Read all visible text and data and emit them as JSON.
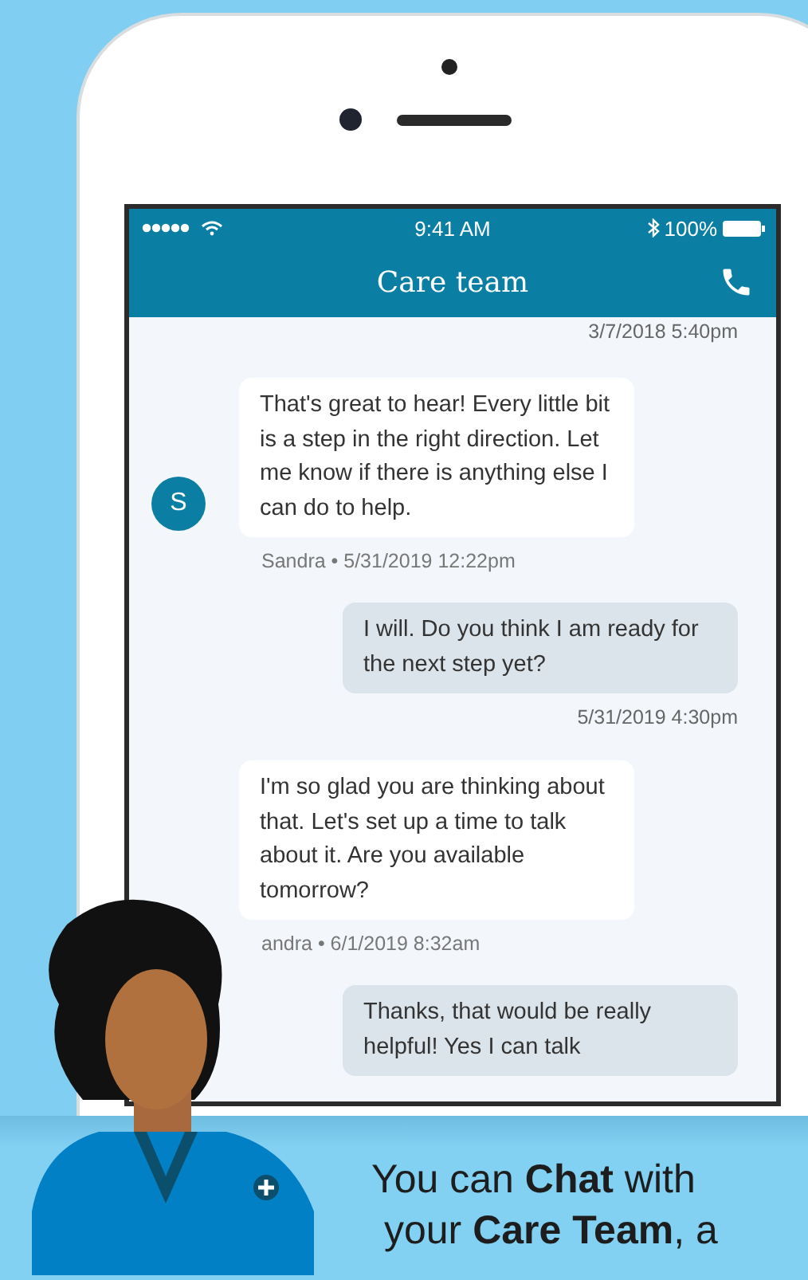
{
  "status_bar": {
    "time": "9:41 AM",
    "battery": "100%"
  },
  "header": {
    "title": "Care team"
  },
  "messages": [
    {
      "kind": "timestamp",
      "text": "3/7/2018 5:40pm"
    },
    {
      "kind": "received",
      "avatar": "S",
      "text": "That's great to hear! Every little bit is a step in the right direction. Let me know if there is anything else I can do to help.",
      "meta": "Sandra • 5/31/2019 12:22pm"
    },
    {
      "kind": "sent",
      "text": "I will. Do you think I am ready for the next step yet?",
      "meta": "5/31/2019 4:30pm"
    },
    {
      "kind": "received",
      "text": "I'm so glad you are thinking about that. Let's set up a time to talk about it. Are you available tomorrow?",
      "meta": "andra • 6/1/2019 8:32am"
    },
    {
      "kind": "sent",
      "text": "Thanks, that would be really helpful! Yes I can talk"
    }
  ],
  "caption": {
    "lines": [
      "You can **Chat** with",
      "your **Care Team**, a"
    ]
  }
}
